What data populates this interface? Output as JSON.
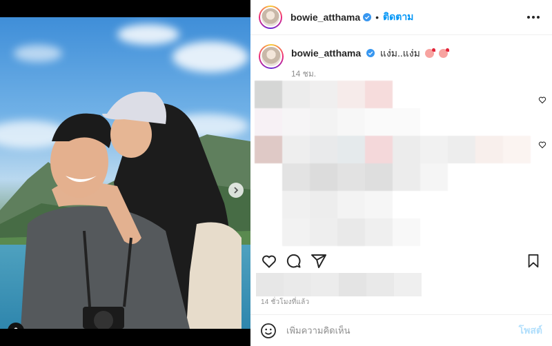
{
  "post": {
    "username": "bowie_atthama",
    "follow_label": "ติดตาม",
    "separator": "•",
    "caption": "แง่ม..แง่ม",
    "caption_time": "14 ชม.",
    "post_time": "14 ชั่วโมงที่แล้ว"
  },
  "comment_bar": {
    "placeholder": "เพิ่มความคิดเห็น",
    "post_label": "โพสต์"
  },
  "icons": {
    "verified": "verified-badge-icon",
    "more": "more-options-icon",
    "like": "heart-icon",
    "comment": "comment-icon",
    "share": "share-icon",
    "save": "bookmark-icon",
    "emoji": "emoji-icon",
    "next": "chevron-right-icon",
    "tag": "user-tag-icon"
  },
  "colors": {
    "accent": "#0095f6",
    "verified": "#3897f0",
    "post_disabled": "#b2dffc",
    "muted": "#8e8e8e"
  },
  "carousel": {
    "slides": 3,
    "active": 1
  }
}
